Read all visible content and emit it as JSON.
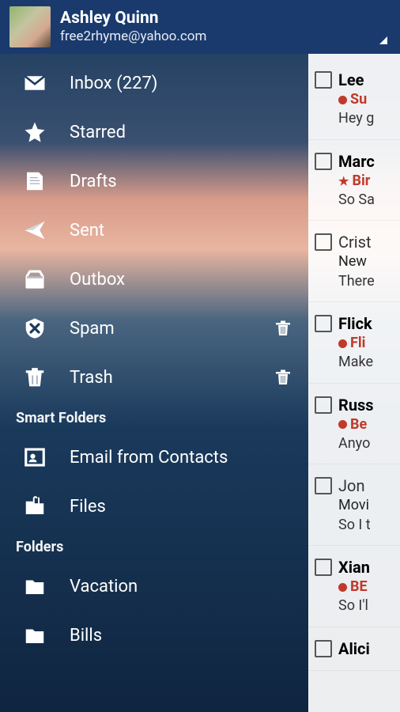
{
  "header": {
    "user_name": "Ashley Quinn",
    "user_email": "free2rhyme@yahoo.com"
  },
  "sidebar": {
    "main": [
      {
        "icon": "envelope-icon",
        "label": "Inbox (227)",
        "has_trash": false
      },
      {
        "icon": "star-icon",
        "label": "Starred",
        "has_trash": false
      },
      {
        "icon": "drafts-icon",
        "label": "Drafts",
        "has_trash": false
      },
      {
        "icon": "sent-icon",
        "label": "Sent",
        "has_trash": false
      },
      {
        "icon": "outbox-icon",
        "label": "Outbox",
        "has_trash": false
      },
      {
        "icon": "spam-icon",
        "label": "Spam",
        "has_trash": true
      },
      {
        "icon": "trash-icon",
        "label": "Trash",
        "has_trash": true
      }
    ],
    "smart_header": "Smart Folders",
    "smart": [
      {
        "icon": "contacts-mail-icon",
        "label": "Email from Contacts"
      },
      {
        "icon": "files-icon",
        "label": "Files"
      }
    ],
    "folders_header": "Folders",
    "folders": [
      {
        "icon": "folder-icon",
        "label": "Vacation"
      },
      {
        "icon": "folder-icon",
        "label": "Bills"
      }
    ]
  },
  "mail": [
    {
      "sender": "Lee",
      "subject": "Su",
      "preview": "Hey g",
      "unread": true,
      "marker": "dot"
    },
    {
      "sender": "Marc",
      "subject": "Bir",
      "preview": "So Sa",
      "unread": true,
      "marker": "star"
    },
    {
      "sender": "Crist",
      "subject": "New",
      "preview": "There",
      "unread": false,
      "marker": ""
    },
    {
      "sender": "Flick",
      "subject": "Fli",
      "preview": "Make",
      "unread": true,
      "marker": "dot"
    },
    {
      "sender": "Russ",
      "subject": "Be",
      "preview": "Anyo",
      "unread": true,
      "marker": "dot"
    },
    {
      "sender": "Jon",
      "subject": "Movi",
      "preview": "So I t",
      "unread": false,
      "marker": ""
    },
    {
      "sender": "Xian",
      "subject": "BE",
      "preview": "So I'l",
      "unread": true,
      "marker": "dot"
    },
    {
      "sender": "Alici",
      "subject": "",
      "preview": "",
      "unread": true,
      "marker": ""
    }
  ]
}
